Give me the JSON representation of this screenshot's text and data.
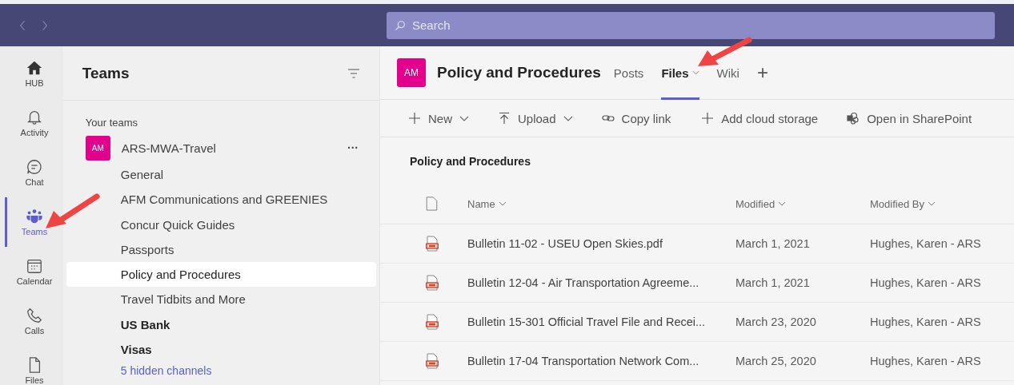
{
  "topbar": {
    "search_placeholder": "Search"
  },
  "rail": [
    {
      "label": "HUB",
      "selected": false
    },
    {
      "label": "Activity",
      "selected": false
    },
    {
      "label": "Chat",
      "selected": false
    },
    {
      "label": "Teams",
      "selected": true
    },
    {
      "label": "Calendar",
      "selected": false
    },
    {
      "label": "Calls",
      "selected": false
    },
    {
      "label": "Files",
      "selected": false
    }
  ],
  "teams_panel": {
    "title": "Teams",
    "section": "Your teams",
    "team": {
      "avatar": "AM",
      "name": "ARS-MWA-Travel",
      "more": "···"
    },
    "channels": [
      {
        "name": "General",
        "selected": false,
        "unread": false
      },
      {
        "name": "AFM Communications and GREENIES",
        "selected": false,
        "unread": false
      },
      {
        "name": "Concur Quick Guides",
        "selected": false,
        "unread": false
      },
      {
        "name": "Passports",
        "selected": false,
        "unread": false
      },
      {
        "name": "Policy and Procedures",
        "selected": true,
        "unread": false
      },
      {
        "name": "Travel Tidbits and More",
        "selected": false,
        "unread": false
      },
      {
        "name": "US Bank",
        "selected": false,
        "unread": true
      },
      {
        "name": "Visas",
        "selected": false,
        "unread": true
      }
    ],
    "hidden_link": "5 hidden channels"
  },
  "channel_header": {
    "avatar": "AM",
    "title": "Policy and Procedures",
    "tabs": [
      {
        "label": "Posts",
        "selected": false,
        "dropdown": false
      },
      {
        "label": "Files",
        "selected": true,
        "dropdown": true
      },
      {
        "label": "Wiki",
        "selected": false,
        "dropdown": false
      }
    ],
    "add_tab": "+"
  },
  "toolbar": [
    {
      "label": "New",
      "dropdown": true
    },
    {
      "label": "Upload",
      "dropdown": true
    },
    {
      "label": "Copy link",
      "dropdown": false
    },
    {
      "label": "Add cloud storage",
      "dropdown": false
    },
    {
      "label": "Open in SharePoint",
      "dropdown": false
    }
  ],
  "files": {
    "breadcrumb": "Policy and Procedures",
    "columns": [
      "Name",
      "Modified",
      "Modified By"
    ],
    "rows": [
      {
        "name": "Bulletin 11-02 - USEU Open Skies.pdf",
        "modified": "March 1, 2021",
        "modified_by": "Hughes, Karen - ARS"
      },
      {
        "name": "Bulletin 12-04 - Air Transportation Agreeme...",
        "modified": "March 1, 2021",
        "modified_by": "Hughes, Karen - ARS"
      },
      {
        "name": "Bulletin 15-301 Official Travel File and Recei...",
        "modified": "March 23, 2020",
        "modified_by": "Hughes, Karen - ARS"
      },
      {
        "name": "Bulletin 17-04 Transportation Network Com...",
        "modified": "March 25, 2020",
        "modified_by": "Hughes, Karen - ARS"
      }
    ]
  }
}
